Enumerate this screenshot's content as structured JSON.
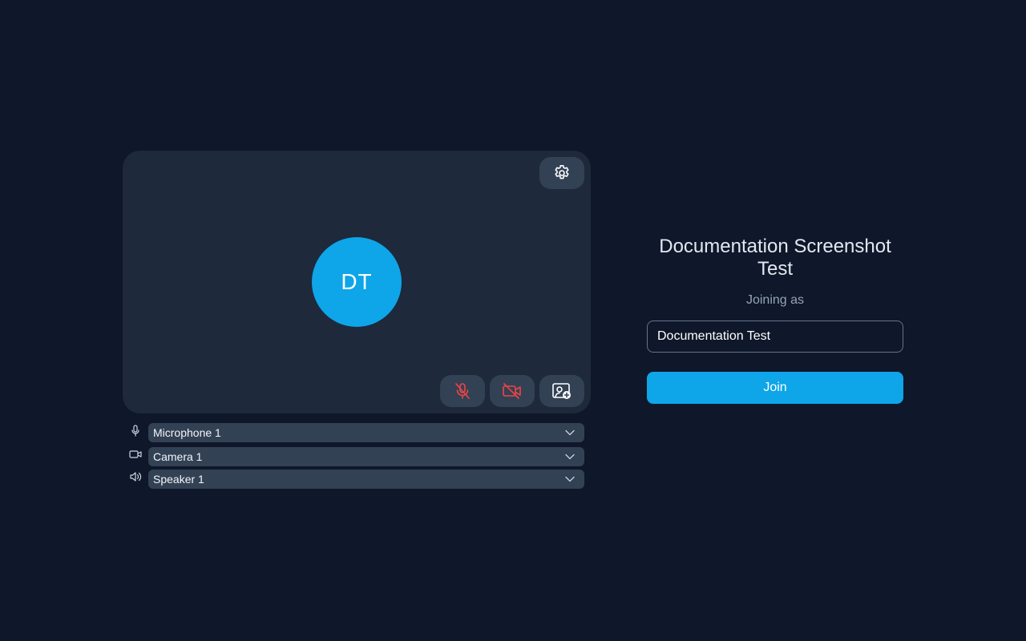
{
  "preview": {
    "avatar_initials": "DT",
    "avatar_color": "#0ea5e9",
    "settings_icon": "gear-icon",
    "controls": [
      {
        "name": "microphone-muted",
        "icon": "mic-off-icon",
        "color": "#ef4444"
      },
      {
        "name": "camera-off",
        "icon": "video-off-icon",
        "color": "#ef4444"
      },
      {
        "name": "background-effects",
        "icon": "background-blur-icon",
        "color": "#ffffff"
      }
    ]
  },
  "devices": {
    "microphone": {
      "icon": "microphone-icon",
      "selected": "Microphone 1"
    },
    "camera": {
      "icon": "camera-icon",
      "selected": "Camera 1"
    },
    "speaker": {
      "icon": "speaker-icon",
      "selected": "Speaker 1"
    }
  },
  "join": {
    "meeting_title": "Documentation Screenshot Test",
    "joining_as_label": "Joining as",
    "name_value": "Documentation Test",
    "join_label": "Join",
    "accent_color": "#0ea5e9"
  }
}
